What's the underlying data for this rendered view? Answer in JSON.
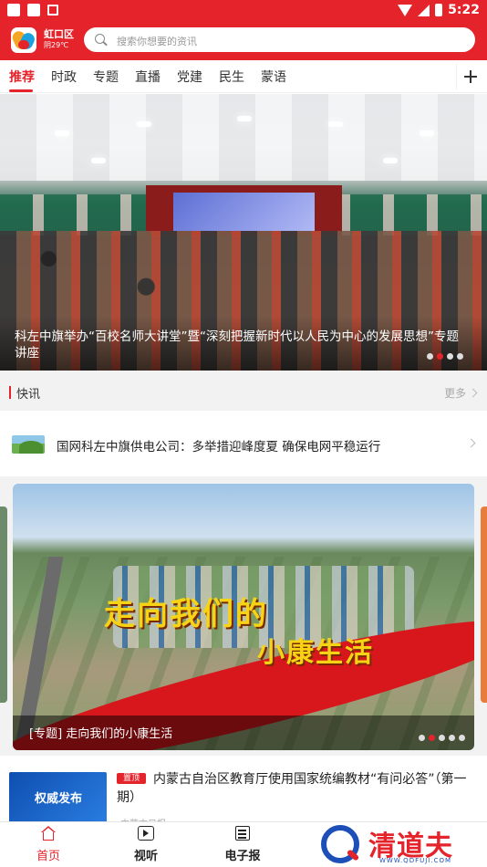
{
  "status_bar": {
    "time": "5:22"
  },
  "header": {
    "location": "虹口区",
    "weather": "阴29℃",
    "search_placeholder": "搜索你想要的资讯"
  },
  "tabs": [
    {
      "label": "推荐",
      "active": true
    },
    {
      "label": "时政"
    },
    {
      "label": "专题"
    },
    {
      "label": "直播"
    },
    {
      "label": "党建"
    },
    {
      "label": "民生"
    },
    {
      "label": "蒙语"
    }
  ],
  "hero": {
    "caption": "科左中旗举办“百校名师大讲堂”暨“深刻把握新时代以人民为中心的发展思想”专题讲座",
    "dots": 4,
    "active_dot": 1
  },
  "flash": {
    "title": "快讯",
    "more": "更多",
    "item": "国网科左中旗供电公司：多举措迎峰度夏  确保电网平稳运行"
  },
  "banner": {
    "slogan_line1": "走向我们的",
    "slogan_line2": "小康生活",
    "caption": "[专题] 走向我们的小康生活",
    "dots": 5,
    "active_dot": 1
  },
  "news": {
    "thumb_text": "权威发布",
    "badge": "置顶",
    "title": "内蒙古自治区教育厅使用国家统编教材“有问必答”（第一期）",
    "source": "内蒙古日报"
  },
  "bottom_nav": [
    {
      "label": "首页",
      "icon": "home-icon",
      "active": true
    },
    {
      "label": "视听",
      "icon": "video-icon"
    },
    {
      "label": "电子报",
      "icon": "newspaper-icon"
    }
  ],
  "watermark": {
    "brand": "清道夫",
    "url": "WWW.QDFUJI.COM"
  },
  "colors": {
    "accent": "#e4232b",
    "brand_blue": "#1d4fb8"
  }
}
